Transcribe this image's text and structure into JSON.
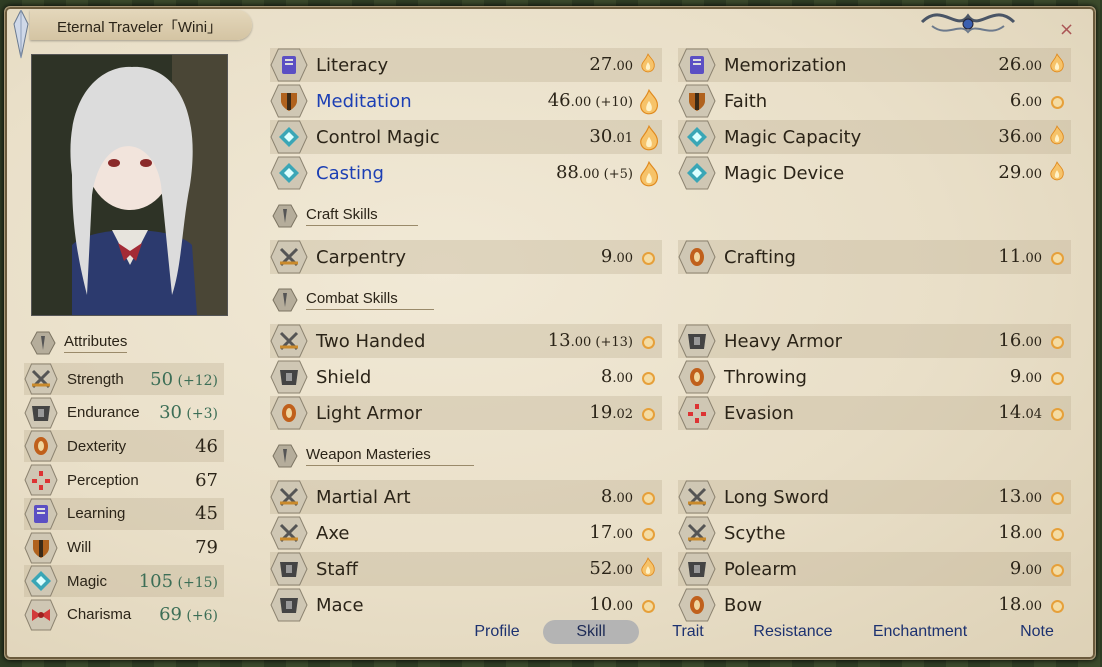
{
  "window": {
    "title": "Eternal Traveler「Wini」",
    "close_label": "×"
  },
  "attributes": {
    "header": "Attributes",
    "items": [
      {
        "name": "Strength",
        "value": "50",
        "bonus": "(+12)",
        "icon": "crossed-swords-icon",
        "highlight": true
      },
      {
        "name": "Endurance",
        "value": "30",
        "bonus": "(+3)",
        "icon": "armor-icon",
        "highlight": true
      },
      {
        "name": "Dexterity",
        "value": "46",
        "bonus": "",
        "icon": "ring-icon",
        "highlight": false
      },
      {
        "name": "Perception",
        "value": "67",
        "bonus": "",
        "icon": "perception-icon",
        "highlight": false
      },
      {
        "name": "Learning",
        "value": "45",
        "bonus": "",
        "icon": "book-icon",
        "highlight": false
      },
      {
        "name": "Will",
        "value": "79",
        "bonus": "",
        "icon": "shield-icon",
        "highlight": false
      },
      {
        "name": "Magic",
        "value": "105",
        "bonus": "(+15)",
        "icon": "magic-icon",
        "highlight": true
      },
      {
        "name": "Charisma",
        "value": "69",
        "bonus": "(+6)",
        "icon": "bow-ribbon-icon",
        "highlight": true
      }
    ]
  },
  "skills": {
    "general": [
      {
        "name": "Literacy",
        "value": "27",
        "dec": ".00",
        "bonus": "",
        "icon": "book-icon",
        "mark": "flame",
        "blue": false
      },
      {
        "name": "Memorization",
        "value": "26",
        "dec": ".00",
        "bonus": "",
        "icon": "book-icon",
        "mark": "flame",
        "blue": false
      },
      {
        "name": "Meditation",
        "value": "46",
        "dec": ".00",
        "bonus": "(+10)",
        "icon": "shield-icon",
        "mark": "flame-big",
        "blue": true
      },
      {
        "name": "Faith",
        "value": "6",
        "dec": ".00",
        "bonus": "",
        "icon": "shield-icon",
        "mark": "dot",
        "blue": false
      },
      {
        "name": "Control Magic",
        "value": "30",
        "dec": ".01",
        "bonus": "",
        "icon": "magic-icon",
        "mark": "flame-big",
        "blue": false
      },
      {
        "name": "Magic Capacity",
        "value": "36",
        "dec": ".00",
        "bonus": "",
        "icon": "magic-icon",
        "mark": "flame",
        "blue": false
      },
      {
        "name": "Casting",
        "value": "88",
        "dec": ".00",
        "bonus": "(+5)",
        "icon": "magic-icon",
        "mark": "flame-big",
        "blue": true
      },
      {
        "name": "Magic Device",
        "value": "29",
        "dec": ".00",
        "bonus": "",
        "icon": "magic-icon",
        "mark": "flame",
        "blue": false
      }
    ],
    "craft_header": "Craft Skills",
    "craft": [
      {
        "name": "Carpentry",
        "value": "9",
        "dec": ".00",
        "bonus": "",
        "icon": "crossed-swords-icon",
        "mark": "dot",
        "blue": false
      },
      {
        "name": "Crafting",
        "value": "11",
        "dec": ".00",
        "bonus": "",
        "icon": "ring-icon",
        "mark": "dot",
        "blue": false
      }
    ],
    "combat_header": "Combat Skills",
    "combat": [
      {
        "name": "Two Handed",
        "value": "13",
        "dec": ".00",
        "bonus": "(+13)",
        "icon": "crossed-swords-icon",
        "mark": "dot",
        "blue": false
      },
      {
        "name": "Heavy Armor",
        "value": "16",
        "dec": ".00",
        "bonus": "",
        "icon": "armor-icon",
        "mark": "dot",
        "blue": false
      },
      {
        "name": "Shield",
        "value": "8",
        "dec": ".00",
        "bonus": "",
        "icon": "armor-icon",
        "mark": "dot",
        "blue": false
      },
      {
        "name": "Throwing",
        "value": "9",
        "dec": ".00",
        "bonus": "",
        "icon": "ring-icon",
        "mark": "dot",
        "blue": false
      },
      {
        "name": "Light Armor",
        "value": "19",
        "dec": ".02",
        "bonus": "",
        "icon": "ring-icon",
        "mark": "dot",
        "blue": false
      },
      {
        "name": "Evasion",
        "value": "14",
        "dec": ".04",
        "bonus": "",
        "icon": "perception-icon",
        "mark": "dot",
        "blue": false
      }
    ],
    "weapon_header": "Weapon Masteries",
    "weapon": [
      {
        "name": "Martial Art",
        "value": "8",
        "dec": ".00",
        "bonus": "",
        "icon": "crossed-swords-icon",
        "mark": "dot",
        "blue": false
      },
      {
        "name": "Long Sword",
        "value": "13",
        "dec": ".00",
        "bonus": "",
        "icon": "crossed-swords-icon",
        "mark": "dot",
        "blue": false
      },
      {
        "name": "Axe",
        "value": "17",
        "dec": ".00",
        "bonus": "",
        "icon": "crossed-swords-icon",
        "mark": "dot",
        "blue": false
      },
      {
        "name": "Scythe",
        "value": "18",
        "dec": ".00",
        "bonus": "",
        "icon": "crossed-swords-icon",
        "mark": "dot",
        "blue": false
      },
      {
        "name": "Staff",
        "value": "52",
        "dec": ".00",
        "bonus": "",
        "icon": "armor-icon",
        "mark": "flame",
        "blue": false
      },
      {
        "name": "Polearm",
        "value": "9",
        "dec": ".00",
        "bonus": "",
        "icon": "armor-icon",
        "mark": "dot",
        "blue": false
      },
      {
        "name": "Mace",
        "value": "10",
        "dec": ".00",
        "bonus": "",
        "icon": "armor-icon",
        "mark": "dot",
        "blue": false
      },
      {
        "name": "Bow",
        "value": "18",
        "dec": ".00",
        "bonus": "",
        "icon": "ring-icon",
        "mark": "dot",
        "blue": false
      }
    ]
  },
  "tabs": [
    {
      "label": "Profile",
      "active": false
    },
    {
      "label": "Skill",
      "active": true
    },
    {
      "label": "Trait",
      "active": false
    },
    {
      "label": "Resistance",
      "active": false
    },
    {
      "label": "Enchantment",
      "active": false
    },
    {
      "label": "Note",
      "active": false
    }
  ],
  "colors": {
    "bonus_green": "#3c6e56",
    "trained_blue": "#1c3fb4",
    "tab_text": "#1d3270"
  }
}
